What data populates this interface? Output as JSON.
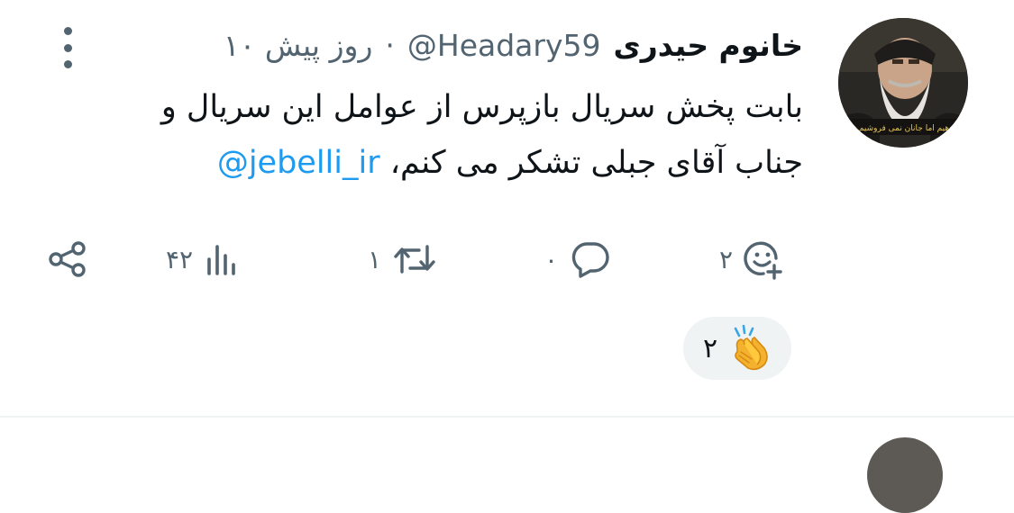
{
  "post": {
    "author_name": "خانوم حیدری",
    "handle": "@Headary59",
    "separator": "·",
    "timestamp": "۱۰ روز پیش",
    "text_line1": "بابت پخش سریال بازپرس از عوامل این سریال و",
    "text_line2": "جناب آقای جبلی تشکر می کنم،",
    "mention": "@jebelli_ir",
    "avatar_caption": "دهیم اما جانان نمی فروشیم"
  },
  "actions": {
    "reactions_count": "۲",
    "replies_count": "۰",
    "reposts_count": "۱",
    "views_count": "۴۲"
  },
  "reaction_pill": {
    "emoji": "👏",
    "count": "۲"
  },
  "colors": {
    "accent": "#1d9bf0",
    "secondary_text": "#536471",
    "primary_text": "#0f1419",
    "pill_bg": "#eff3f4"
  }
}
